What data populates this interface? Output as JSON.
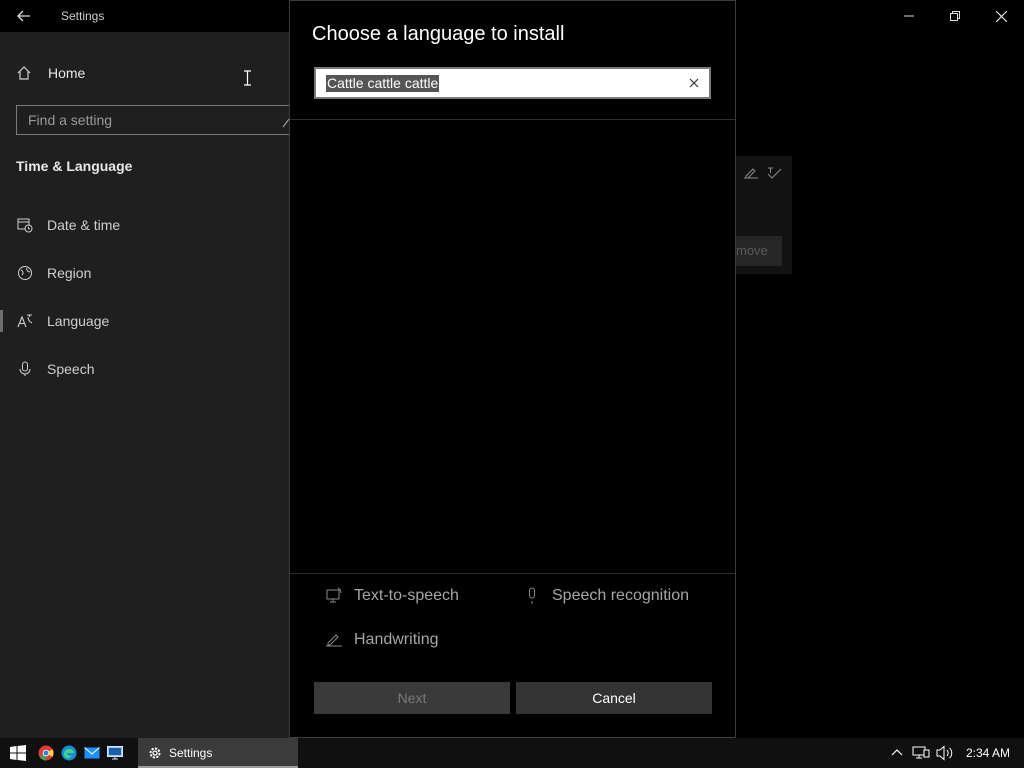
{
  "window": {
    "title": "Settings"
  },
  "sidebar": {
    "home_label": "Home",
    "search_placeholder": "Find a setting",
    "section_title": "Time & Language",
    "items": [
      {
        "label": "Date & time",
        "icon": "calendar-clock-icon"
      },
      {
        "label": "Region",
        "icon": "globe-icon"
      },
      {
        "label": "Language",
        "icon": "language-icon",
        "active": true
      },
      {
        "label": "Speech",
        "icon": "microphone-icon"
      }
    ]
  },
  "background": {
    "remove_button_partial": "move"
  },
  "dialog": {
    "title": "Choose a language to install",
    "search_value": "Cattle cattle cattle",
    "features": [
      {
        "label": "Text-to-speech",
        "icon": "text-to-speech-icon"
      },
      {
        "label": "Speech recognition",
        "icon": "microphone-icon"
      },
      {
        "label": "Handwriting",
        "icon": "handwriting-icon"
      }
    ],
    "next_label": "Next",
    "cancel_label": "Cancel"
  },
  "taskbar": {
    "pinned": [
      "windows-start-icon",
      "chrome-icon",
      "edge-icon",
      "mail-icon",
      "remote-desktop-icon"
    ],
    "active_app_label": "Settings",
    "clock": "2:34 AM"
  },
  "colors": {
    "background": "#000000",
    "sidebar": "#1f1f1f",
    "taskbar": "#101010",
    "button_disabled": "#3a3a3a",
    "button": "#333333"
  }
}
